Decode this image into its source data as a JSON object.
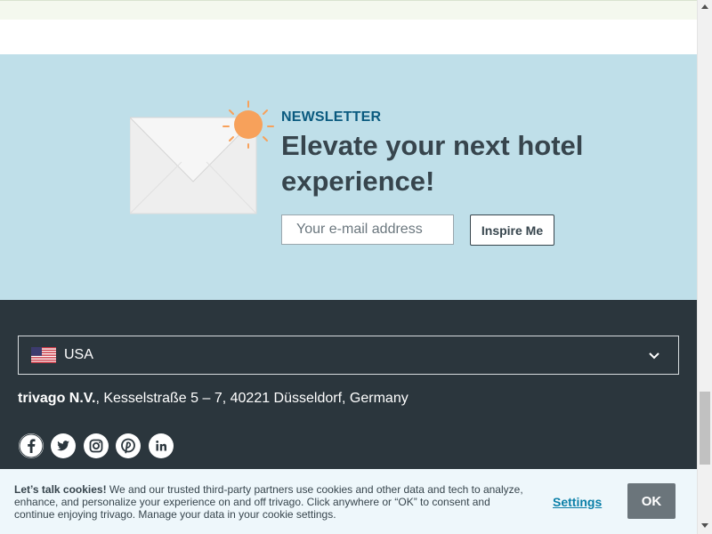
{
  "newsletter": {
    "eyebrow": "NEWSLETTER",
    "title": "Elevate your next hotel experience!",
    "email_placeholder": "Your e-mail address",
    "button_label": "Inspire Me",
    "envelope_icon": "envelope-illustration",
    "sun_icon": "sun-icon"
  },
  "footer": {
    "country": {
      "label": "USA",
      "flag_icon": "us-flag-icon",
      "chevron_icon": "chevron-down-icon"
    },
    "address": {
      "company": "trivago N.V.",
      "rest": ", Kesselstraße 5 – 7, 40221 Düsseldorf, Germany"
    },
    "social": [
      {
        "icon": "facebook-icon"
      },
      {
        "icon": "twitter-icon"
      },
      {
        "icon": "instagram-icon"
      },
      {
        "icon": "pinterest-icon"
      },
      {
        "icon": "linkedin-icon"
      }
    ]
  },
  "cookie_bar": {
    "heading": "Let’s talk cookies!",
    "text": " We and our trusted third-party partners use cookies and other data and tech to analyze, enhance, and personalize your experience on and off trivago. Click anywhere or “OK” to consent and continue enjoying trivago. Manage your data in your cookie settings.",
    "settings_label": "Settings",
    "ok_label": "OK"
  },
  "colors": {
    "newsletter_bg": "#bfdfe9",
    "footer_bg": "#2b363d",
    "accent_text": "#0a5a7f",
    "link": "#0a7fa8",
    "sun": "#f7a15b"
  }
}
